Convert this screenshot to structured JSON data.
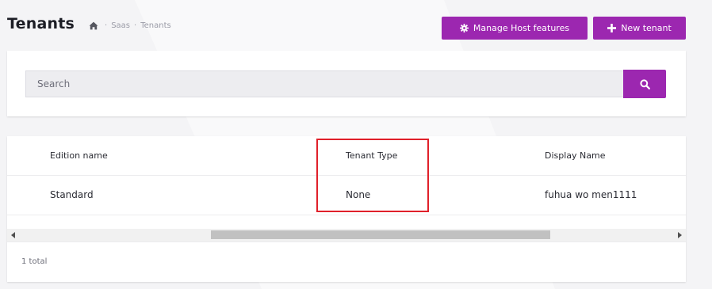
{
  "header": {
    "title": "Tenants",
    "breadcrumb": [
      {
        "icon": "home-icon"
      },
      {
        "label": "Saas"
      },
      {
        "label": "Tenants"
      }
    ],
    "breadcrumb_separator": "·",
    "manage_host_features_label": "Manage Host features",
    "new_tenant_label": "New tenant"
  },
  "search": {
    "placeholder": "Search",
    "value": ""
  },
  "table": {
    "columns": [
      "Edition name",
      "Tenant Type",
      "Display Name"
    ],
    "rows": [
      {
        "edition_name": "Standard",
        "tenant_type": "None",
        "display_name": "fuhua wo men1111"
      }
    ],
    "footer_total": "1 total"
  },
  "colors": {
    "accent": "#9c27b0",
    "highlight": "#e0202a",
    "background": "#f4f4f6"
  }
}
